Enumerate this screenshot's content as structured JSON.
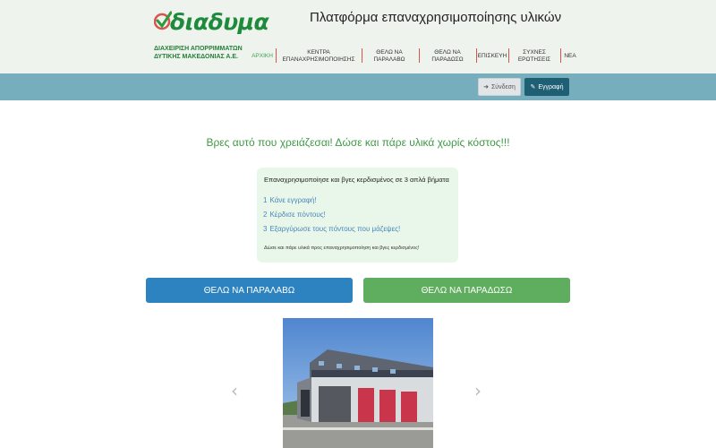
{
  "header": {
    "logo_word": "διαδυμα",
    "logo_sub_line1": "ΔΙΑΧΕΙΡΙΣΗ ΑΠΟΡΡΙΜΜΑΤΩΝ",
    "logo_sub_line2": "ΔΥΤΙΚΗΣ ΜΑΚΕΔΟΝΙΑΣ Α.Ε.",
    "site_title": "Πλατφόρμα επαναχρησιμοποίησης υλικών",
    "nav": [
      {
        "label": "ΑΡΧΙΚΗ",
        "active": true
      },
      {
        "label": "ΚΕΝΤΡΑ ΕΠΑΝΑΧΡΗΣΙΜΟΠΟΙΗΣΗΣ"
      },
      {
        "label": "ΘΕΛΩ ΝΑ ΠΑΡΑΛΑΒΩ"
      },
      {
        "label": "ΘΕΛΩ ΝΑ ΠΑΡΑΔΩΣΩ"
      },
      {
        "label": "ΕΠΙΣΚΕΥΗ"
      },
      {
        "label": "ΣΥΧΝΕΣ ΕΡΩΤΗΣΕΙΣ"
      },
      {
        "label": "ΝΕΑ"
      }
    ]
  },
  "auth": {
    "login_label": "Σύνδεση",
    "register_label": "Εγγραφή"
  },
  "main": {
    "tagline": "Βρες αυτό που χρειάζεσαι! Δώσε και πάρε υλικά χωρίς κόστος!!!",
    "steps_title": "Επαναχρησιμοποίησε και βγες κερδισμένος σε 3 απλά βήματα",
    "steps": [
      {
        "num": "1",
        "text": "Κάνε εγγραφή!"
      },
      {
        "num": "2",
        "text": "Κέρδισε πόντους!"
      },
      {
        "num": "3",
        "text": "Εξαργύρωσε τους πόντους που μάζεψες!"
      }
    ],
    "steps_note": "Δώσε και πάρε υλικά προς επαναχρησιμοποίηση και βγες κερδισμένος!",
    "receive_button": "ΘΕΛΩ ΝΑ ΠΑΡΑΛΑΒΩ",
    "give_button": "ΘΕΛΩ ΝΑ ΠΑΡΑΔΩΣΩ"
  },
  "carousel": {
    "prev_icon": "chevron-left-icon",
    "next_icon": "chevron-right-icon"
  },
  "colors": {
    "header_bg": "#eff3ee",
    "bar_bg": "#76aebd",
    "register_bg": "#1e5f73",
    "receive_bg": "#2c83c0",
    "give_bg": "#5fad5f",
    "tagline": "#3e9a44"
  }
}
